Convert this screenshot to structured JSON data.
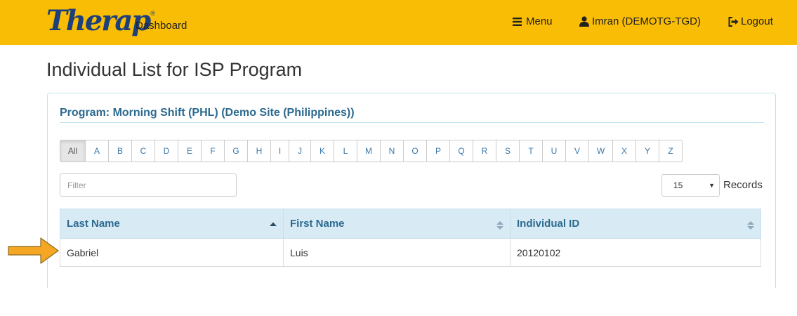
{
  "navbar": {
    "logo_text": "Therap",
    "logo_mark": "®",
    "dashboard_label": "Dashboard",
    "menu_label": "Menu",
    "user_label": "Imran (DEMOTG-TGD)",
    "logout_label": "Logout",
    "icons": [
      "hamburger-icon",
      "user-icon",
      "logout-icon"
    ],
    "background_color": "#f9bd06"
  },
  "page": {
    "title": "Individual List for ISP Program"
  },
  "panel": {
    "program_heading": "Program: Morning Shift (PHL) (Demo Site (Philippines))",
    "accent_color": "#2c6a8f"
  },
  "alphabet": {
    "buttons": [
      "All",
      "A",
      "B",
      "C",
      "D",
      "E",
      "F",
      "G",
      "H",
      "I",
      "J",
      "K",
      "L",
      "M",
      "N",
      "O",
      "P",
      "Q",
      "R",
      "S",
      "T",
      "U",
      "V",
      "W",
      "X",
      "Y",
      "Z"
    ],
    "active": "All"
  },
  "filter": {
    "placeholder": "Filter",
    "value": ""
  },
  "records": {
    "selected": "15",
    "label": "Records"
  },
  "table": {
    "columns": [
      {
        "label": "Last Name",
        "sort": "ascending"
      },
      {
        "label": "First Name",
        "sort": "none"
      },
      {
        "label": "Individual ID",
        "sort": "none"
      }
    ],
    "rows": [
      [
        "Gabriel",
        "Luis",
        "20120102"
      ]
    ]
  },
  "annotation": {
    "icon": "arrow-right-icon",
    "color": "#f5a623"
  }
}
